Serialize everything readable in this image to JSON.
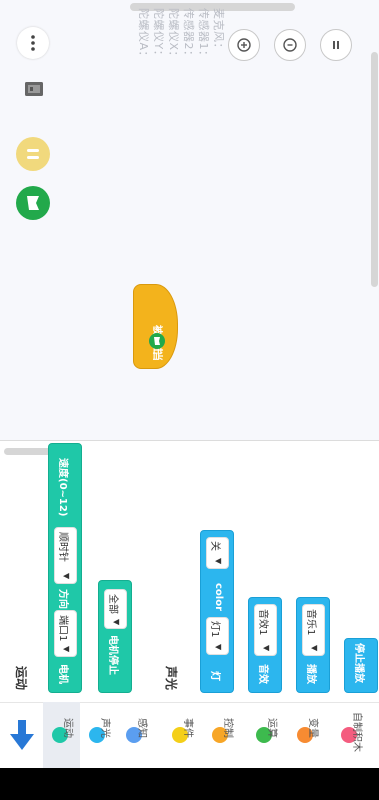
{
  "sensors": [
    {
      "label": "麦克风："
    },
    {
      "label": "传感器1："
    },
    {
      "label": "传感器2："
    },
    {
      "label": "陀螺仪X："
    },
    {
      "label": "陀螺仪Y："
    },
    {
      "label": "陀螺仪A："
    }
  ],
  "hat_block": {
    "prefix": "当",
    "suffix": "被点击"
  },
  "palette": {
    "motion_title": "运动",
    "sound_light_title": "声光",
    "motor_block": {
      "label1": "电机",
      "port": "端口1",
      "label2": "方向",
      "dir": "顺时针",
      "label3": "速度(0~12)"
    },
    "motor_stop_block": {
      "label": "电机停止",
      "value": "全部"
    },
    "light_block": {
      "label": "灯",
      "lamp": "灯1",
      "label2": "color",
      "state": "关"
    },
    "sound_block": {
      "label": "音效",
      "value": "音效1"
    },
    "play_block": {
      "label": "播放",
      "value": "音乐1"
    },
    "stop_play_block": {
      "label": "停止播放"
    }
  },
  "categories": [
    {
      "label": "运动",
      "color": "#1fc8a8"
    },
    {
      "label": "声光",
      "color": "#2cb6ee"
    },
    {
      "label": "感知",
      "color": "#5b9ef0"
    },
    {
      "label": "事件",
      "color": "#f4cf19"
    },
    {
      "label": "控制",
      "color": "#f7a627"
    },
    {
      "label": "运算",
      "color": "#3dba4e"
    },
    {
      "label": "变量",
      "color": "#f78b32"
    },
    {
      "label": "自制积木",
      "color": "#f45c7f"
    }
  ],
  "colors": {
    "accent_green": "#22a94b",
    "event_yellow": "#f3b31c",
    "arrow_blue": "#2878d6"
  }
}
